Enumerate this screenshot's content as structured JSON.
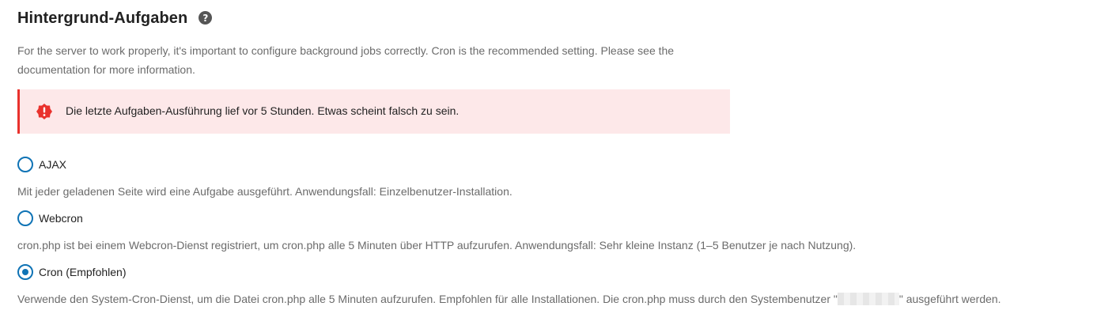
{
  "section": {
    "title": "Hintergrund-Aufgaben",
    "help_icon": "question-circle-icon",
    "intro": "For the server to work properly, it's important to configure background jobs correctly. Cron is the recommended setting. Please see the documentation for more information."
  },
  "alert": {
    "icon": "error-badge-icon",
    "text": "Die letzte Aufgaben-Ausführung lief vor 5 Stunden. Etwas scheint falsch zu sein.",
    "colors": {
      "background": "#fde8e9",
      "border": "#e9322d"
    }
  },
  "options": [
    {
      "label": "AJAX",
      "checked": false,
      "description": "Mit jeder geladenen Seite wird eine Aufgabe ausgeführt. Anwendungsfall: Einzelbenutzer-Installation."
    },
    {
      "label": "Webcron",
      "checked": false,
      "description": "cron.php ist bei einem Webcron-Dienst registriert, um cron.php alle 5 Minuten über HTTP aufzurufen. Anwendungsfall: Sehr kleine Instanz (1–5 Benutzer je nach Nutzung)."
    },
    {
      "label": "Cron (Empfohlen)",
      "checked": true,
      "description_before": "Verwende den System-Cron-Dienst, um die Datei cron.php alle 5 Minuten aufzurufen. Empfohlen für alle Installationen. Die cron.php muss durch den Systembenutzer \"",
      "description_after": "\" ausgeführt werden."
    }
  ],
  "colors": {
    "accent": "#0f73b5",
    "muted_text": "#6b6b6b"
  }
}
